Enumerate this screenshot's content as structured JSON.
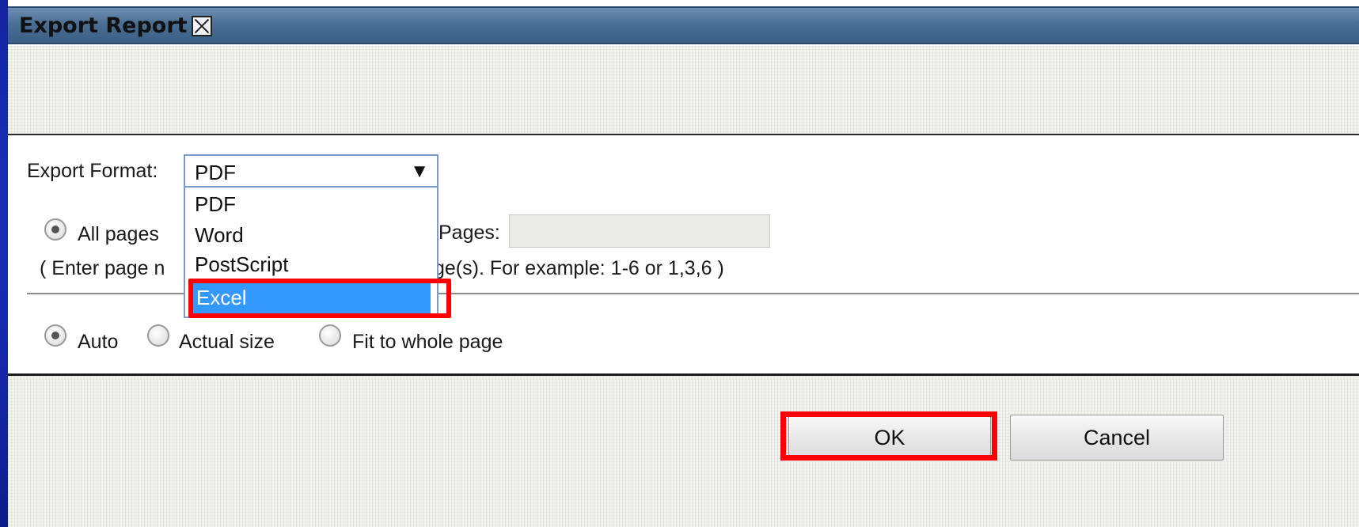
{
  "dialog": {
    "title": "Export Report",
    "title_close_icon": "close-box-icon"
  },
  "format": {
    "label": "Export Format:",
    "selected": "PDF",
    "arrow": "▼",
    "options": [
      "PDF",
      "Word",
      "PostScript",
      "Excel"
    ],
    "highlighted_option": "Excel"
  },
  "range": {
    "all_pages_label": "All pages",
    "pages_label": "Pages:",
    "pages_value": "",
    "hint_prefix": "( Enter page n",
    "hint_suffix": "ge(s). For example: 1-6 or 1,3,6 )"
  },
  "scaling": {
    "options": [
      "Auto",
      "Actual size",
      "Fit to whole page"
    ],
    "selected": "Auto"
  },
  "buttons": {
    "ok": "OK",
    "cancel": "Cancel"
  },
  "annotations": {
    "highlight_color": "#ff0000"
  },
  "colors": {
    "titlebar": "#4a6f94",
    "selection": "#3399ff",
    "background": "#1f35c9"
  }
}
